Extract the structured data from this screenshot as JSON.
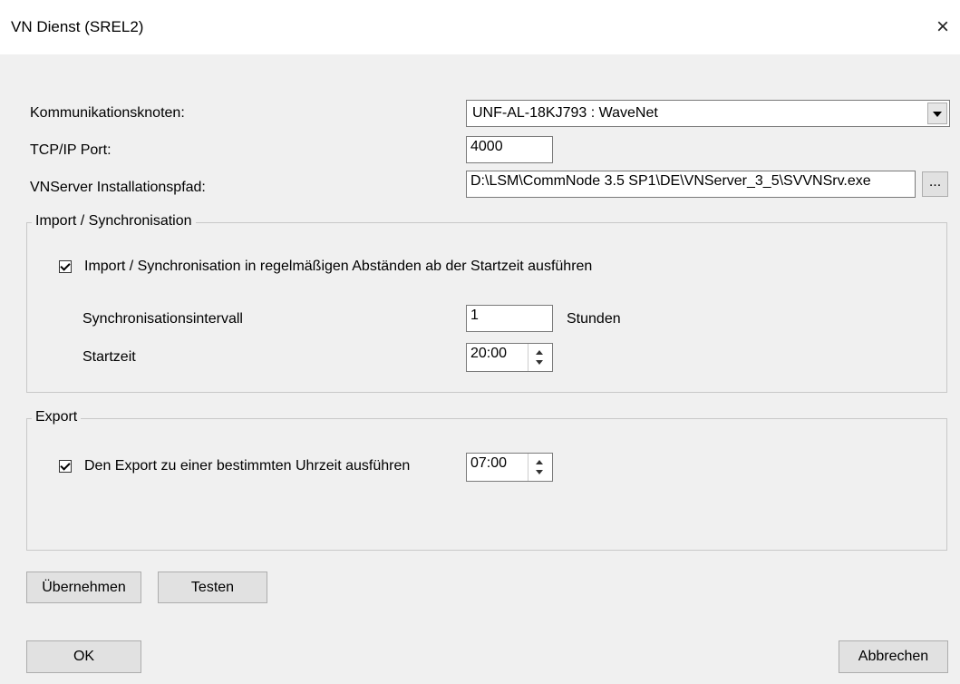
{
  "window": {
    "title": "VN Dienst (SREL2)",
    "close_glyph": "×"
  },
  "fields": {
    "node_label": "Kommunikationsknoten:",
    "node_value": "UNF-AL-18KJ793 : WaveNet",
    "port_label": "TCP/IP Port:",
    "port_value": "4000",
    "path_label": "VNServer Installationspfad:",
    "path_value": "D:\\LSM\\CommNode 3.5 SP1\\DE\\VNServer_3_5\\SVVNSrv.exe",
    "browse_label": "..."
  },
  "import_group": {
    "legend": "Import / Synchronisation",
    "checkbox_label": "Import / Synchronisation in regelmäßigen Abständen ab der Startzeit ausführen",
    "checked": true,
    "interval_label": "Synchronisationsintervall",
    "interval_value": "1",
    "interval_unit": "Stunden",
    "start_label": "Startzeit",
    "start_value": "20:00"
  },
  "export_group": {
    "legend": "Export",
    "checkbox_label": "Den Export zu einer bestimmten Uhrzeit ausführen",
    "checked": true,
    "time_value": "07:00"
  },
  "buttons": {
    "apply": "Übernehmen",
    "test": "Testen",
    "ok": "OK",
    "cancel": "Abbrechen"
  },
  "icons": {
    "close": "close-icon",
    "combo_arrow": "chevron-down-icon",
    "checkbox": "checkmark-icon",
    "spinner": "spin-arrows-icon"
  }
}
